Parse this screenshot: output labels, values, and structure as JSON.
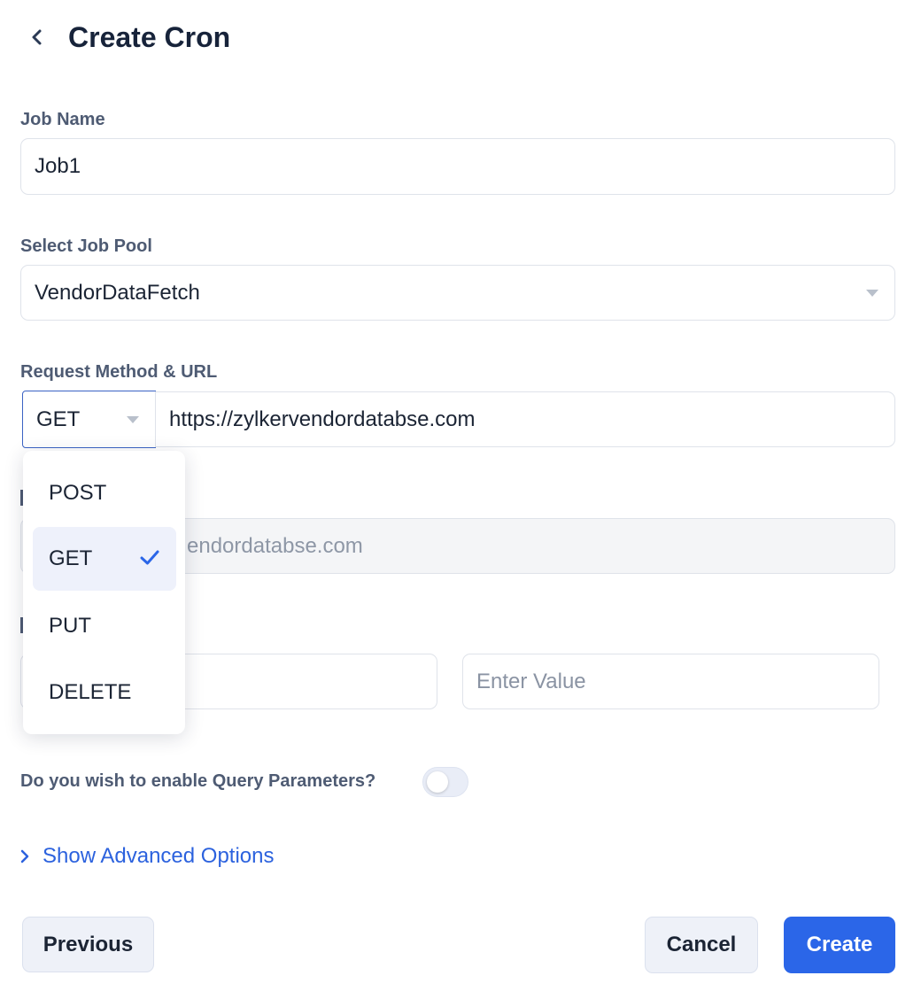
{
  "header": {
    "title": "Create Cron",
    "back_icon": "chevron-left-icon"
  },
  "job_name": {
    "label": "Job Name",
    "value": "Job1"
  },
  "job_pool": {
    "label": "Select Job Pool",
    "value": "VendorDataFetch"
  },
  "request": {
    "label": "Request Method & URL",
    "method": "GET",
    "url": "https://zylkervendordatabse.com"
  },
  "method_dropdown": {
    "options": [
      {
        "label": "POST",
        "selected": false
      },
      {
        "label": "GET",
        "selected": true
      },
      {
        "label": "PUT",
        "selected": false
      },
      {
        "label": "DELETE",
        "selected": false
      }
    ]
  },
  "url_preview": {
    "visible_text": "endordatabse.com"
  },
  "headers": {
    "value_placeholder": "Enter Value"
  },
  "query_params": {
    "label": "Do you wish to enable Query Parameters?",
    "enabled": false
  },
  "advanced": {
    "label": "Show Advanced Options"
  },
  "footer": {
    "previous": "Previous",
    "cancel": "Cancel",
    "create": "Create"
  },
  "colors": {
    "primary": "#2b66e8",
    "label": "#4e5b73",
    "title": "#17233a",
    "focus_border": "#3b63c4"
  }
}
